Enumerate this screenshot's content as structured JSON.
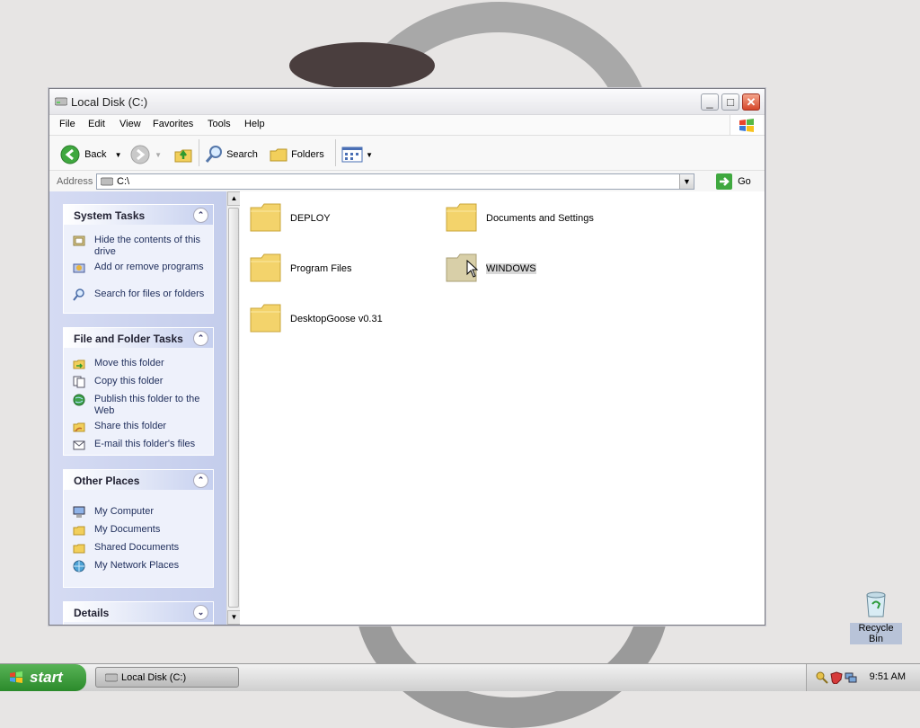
{
  "window": {
    "title": "Local Disk (C:)"
  },
  "menu": [
    "File",
    "Edit",
    "View",
    "Favorites",
    "Tools",
    "Help"
  ],
  "toolbar": {
    "back_label": "Back",
    "search_label": "Search",
    "folders_label": "Folders"
  },
  "address": {
    "label": "Address",
    "value": "C:\\",
    "go_label": "Go"
  },
  "system_tasks": {
    "title": "System Tasks",
    "items": [
      {
        "label": "Hide the contents of this drive",
        "icon": "hide-drive-icon"
      },
      {
        "label": "Add or remove programs",
        "icon": "add-remove-programs-icon"
      },
      {
        "label": "Search for files or folders",
        "icon": "search-icon"
      }
    ]
  },
  "file_folder_tasks": {
    "title": "File and Folder Tasks",
    "items": [
      {
        "label": "Move this folder",
        "icon": "move-folder-icon"
      },
      {
        "label": "Copy this folder",
        "icon": "copy-folder-icon"
      },
      {
        "label": "Publish this folder to the Web",
        "icon": "publish-web-icon"
      },
      {
        "label": "Share this folder",
        "icon": "share-folder-icon"
      },
      {
        "label": "E-mail this folder's files",
        "icon": "email-icon"
      }
    ]
  },
  "other_places": {
    "title": "Other Places",
    "items": [
      {
        "label": "My Computer",
        "icon": "my-computer-icon"
      },
      {
        "label": "My Documents",
        "icon": "my-documents-icon"
      },
      {
        "label": "Shared Documents",
        "icon": "shared-documents-icon"
      },
      {
        "label": "My Network Places",
        "icon": "network-places-icon"
      }
    ]
  },
  "details": {
    "title": "Details"
  },
  "folders": [
    {
      "name": "DEPLOY",
      "selected": false
    },
    {
      "name": "Documents and Settings",
      "selected": false
    },
    {
      "name": "Program Files",
      "selected": false
    },
    {
      "name": "WINDOWS",
      "selected": true
    },
    {
      "name": "DesktopGoose v0.31",
      "selected": false
    }
  ],
  "desktop": {
    "recycle_bin_label": "Recycle Bin"
  },
  "taskbar": {
    "start_label": "start",
    "task_label": "Local Disk (C:)",
    "clock": "9:51 AM"
  },
  "colors": {
    "folder_yellow": "#f5d86a",
    "task_pane_blue": "#c6d0ef",
    "start_green": "#3c9a3c"
  }
}
